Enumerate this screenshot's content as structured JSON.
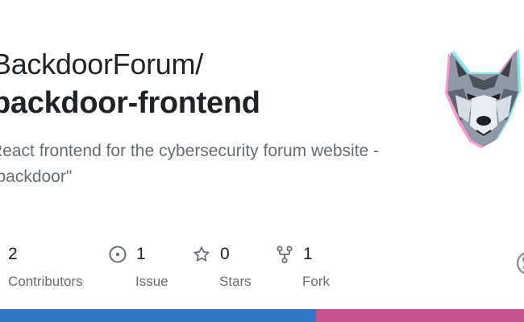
{
  "repo": {
    "owner": "BackdoorForum/",
    "name": "backdoor-frontend",
    "description": "React frontend for the cybersecurity forum website - \"backdoor\""
  },
  "stats": [
    {
      "icon": "people-icon",
      "value": "2",
      "label": "Contributors"
    },
    {
      "icon": "issue-icon",
      "value": "1",
      "label": "Issue"
    },
    {
      "icon": "star-icon",
      "value": "0",
      "label": "Stars"
    },
    {
      "icon": "fork-icon",
      "value": "1",
      "label": "Fork"
    }
  ],
  "avatar": {
    "icon": "wolf-avatar-icon"
  },
  "language_bar": {
    "segments": [
      {
        "color": "#3178c6",
        "share": 0.603
      },
      {
        "color": "#c6538c",
        "share": 0.397
      }
    ]
  }
}
